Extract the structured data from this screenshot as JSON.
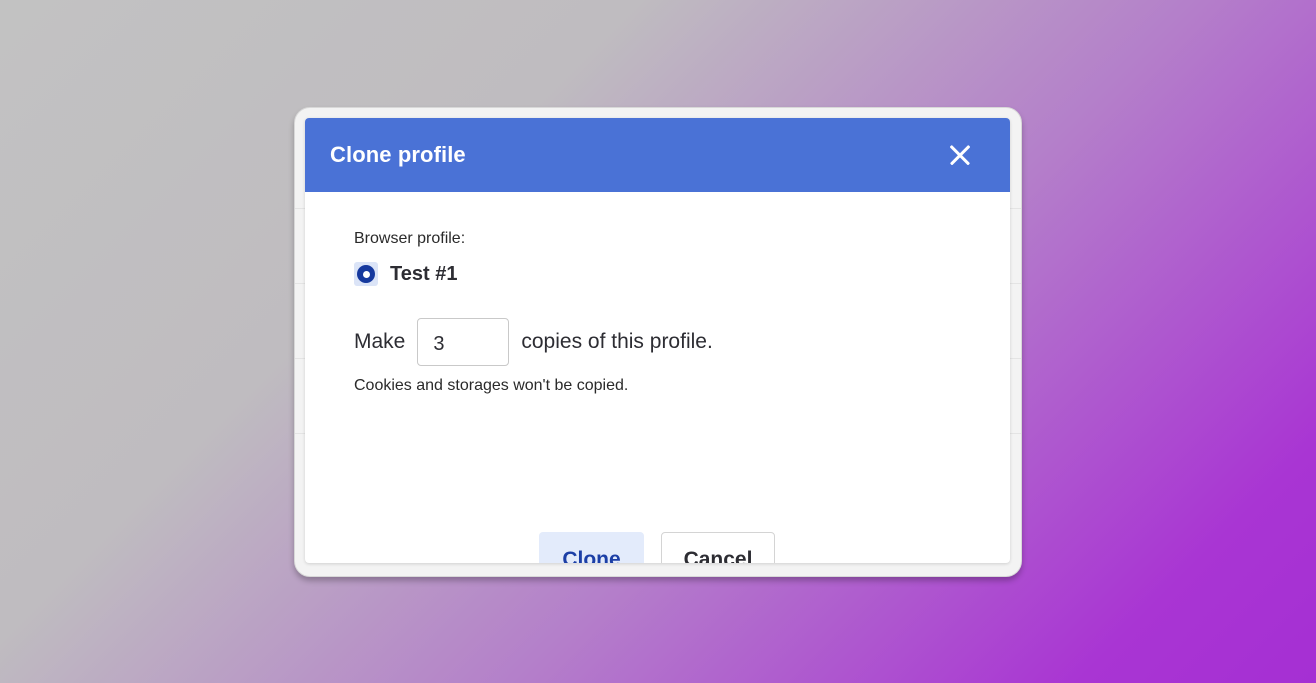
{
  "dialog": {
    "title": "Clone profile",
    "close_icon": "close-icon",
    "browser_profile_label": "Browser profile:",
    "profile_option": {
      "label": "Test #1",
      "selected": true
    },
    "copies": {
      "prefix": "Make",
      "value": "3",
      "suffix": "copies of this profile."
    },
    "note": "Cookies and storages won't be copied.",
    "clone_label": "Clone",
    "cancel_label": "Cancel"
  },
  "colors": {
    "header": "#4a72d6",
    "primary_text": "#1c3fa6",
    "primary_bg": "#e3ebfb",
    "radio": "#16399e"
  }
}
